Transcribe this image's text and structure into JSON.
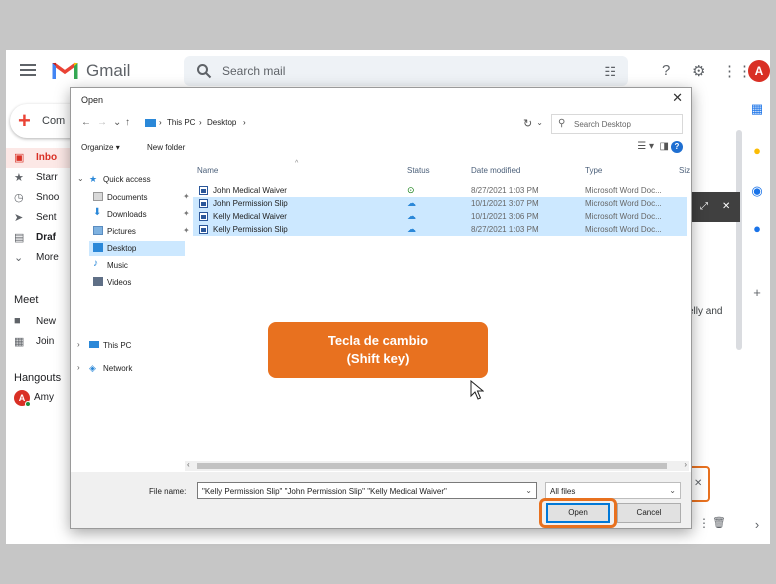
{
  "gmail": {
    "app_name": "Gmail",
    "search_placeholder": "Search mail",
    "avatar_initial": "A",
    "compose_label": "Com",
    "nav": [
      {
        "label": "Inbo",
        "icon": "inbox-icon",
        "active": true
      },
      {
        "label": "Starr",
        "icon": "star-icon"
      },
      {
        "label": "Snoo",
        "icon": "clock-icon"
      },
      {
        "label": "Sent",
        "icon": "send-icon"
      },
      {
        "label": "Draf",
        "icon": "draft-icon"
      },
      {
        "label": "More",
        "icon": "chevron-down-icon"
      }
    ],
    "meet": {
      "heading": "Meet",
      "items": [
        "New",
        "Join"
      ]
    },
    "hangouts": {
      "heading": "Hangouts",
      "user": "Amy"
    },
    "partial_text": "elly and",
    "accent": "#ea4335"
  },
  "dialog": {
    "title": "Open",
    "breadcrumb": [
      "This PC",
      "Desktop"
    ],
    "search_placeholder": "Search Desktop",
    "organize_label": "Organize",
    "new_folder_label": "New folder",
    "nav_pane": [
      {
        "label": "Quick access",
        "kind": "star-icon",
        "expanded": true
      },
      {
        "label": "Documents",
        "kind": "documents-icon",
        "pinned": true
      },
      {
        "label": "Downloads",
        "kind": "downloads-icon",
        "pinned": true
      },
      {
        "label": "Pictures",
        "kind": "pictures-icon",
        "pinned": true
      },
      {
        "label": "Desktop",
        "kind": "desktop-icon",
        "selected": true
      },
      {
        "label": "Music",
        "kind": "music-icon"
      },
      {
        "label": "Videos",
        "kind": "videos-icon"
      },
      {
        "label": "This PC",
        "kind": "pc-icon"
      },
      {
        "label": "Network",
        "kind": "network-icon"
      }
    ],
    "columns": [
      "Name",
      "Status",
      "Date modified",
      "Type",
      "Siz"
    ],
    "files": [
      {
        "name": "John Medical Waiver",
        "status": "synced",
        "date": "8/27/2021 1:03 PM",
        "type": "Microsoft Word Doc...",
        "selected": false
      },
      {
        "name": "John Permission Slip",
        "status": "cloud",
        "date": "10/1/2021 3:07 PM",
        "type": "Microsoft Word Doc...",
        "selected": true
      },
      {
        "name": "Kelly Medical Waiver",
        "status": "cloud",
        "date": "10/1/2021 3:06 PM",
        "type": "Microsoft Word Doc...",
        "selected": true
      },
      {
        "name": "Kelly Permission Slip",
        "status": "cloud",
        "date": "8/27/2021 1:03 PM",
        "type": "Microsoft Word Doc...",
        "selected": true
      }
    ],
    "file_name_label": "File name:",
    "file_name_value": "\"Kelly Permission Slip\" \"John Permission Slip\" \"Kelly Medical Waiver\"",
    "file_type": "All files",
    "open_label": "Open",
    "cancel_label": "Cancel"
  },
  "callout": {
    "line1": "Tecla de cambio",
    "line2": "(Shift key)",
    "color": "#e8711f"
  }
}
